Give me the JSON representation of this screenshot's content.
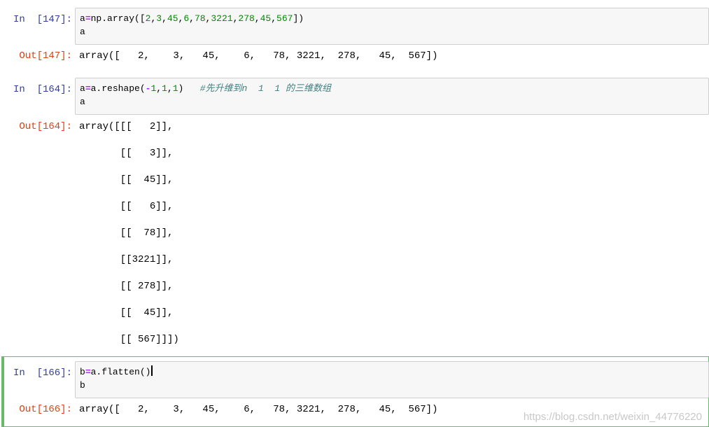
{
  "cells": [
    {
      "in_prompt": "In  [147]:",
      "code_lines": [
        "a=np.array([2,3,45,6,78,3221,278,45,567])",
        "a"
      ],
      "out_prompt": "Out[147]:",
      "output_lines": [
        "array([   2,    3,   45,    6,   78, 3221,  278,   45,  567])"
      ]
    },
    {
      "in_prompt": "In  [164]:",
      "code_lines": [
        "a=a.reshape(-1,1,1)   ",
        "a"
      ],
      "comment": "#先升维到n  1  1 的三维数组",
      "out_prompt": "Out[164]:",
      "output_lines": [
        "array([[[   2]],",
        "       [[   3]],",
        "       [[  45]],",
        "       [[   6]],",
        "       [[  78]],",
        "       [[3221]],",
        "       [[ 278]],",
        "       [[  45]],",
        "       [[ 567]]])"
      ]
    },
    {
      "in_prompt": "In  [166]:",
      "code_lines": [
        "b=a.flatten()",
        "b"
      ],
      "out_prompt": "Out[166]:",
      "output_lines": [
        "array([   2,    3,   45,    6,   78, 3221,  278,   45,  567])"
      ]
    }
  ],
  "watermark": "https://blog.csdn.net/weixin_44776220",
  "colors": {
    "in_prompt": "#303f9f",
    "out_prompt": "#d84315",
    "selected_border": "#66bb6a",
    "input_bg": "#f7f7f7"
  }
}
